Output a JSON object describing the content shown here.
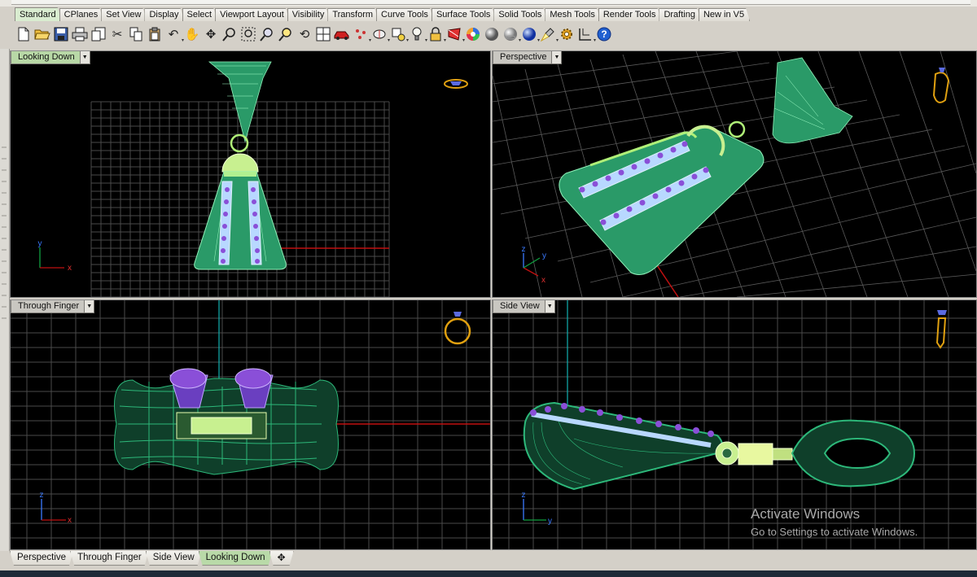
{
  "tool_tabs": [
    "Standard",
    "CPlanes",
    "Set View",
    "Display",
    "Select",
    "Viewport Layout",
    "Visibility",
    "Transform",
    "Curve Tools",
    "Surface Tools",
    "Solid Tools",
    "Mesh Tools",
    "Render Tools",
    "Drafting",
    "New in V5"
  ],
  "active_tool_tab": 0,
  "toolbar_icons": [
    "new-icon",
    "open-icon",
    "save-icon",
    "print-icon",
    "import-icon",
    "cut-icon",
    "copy-icon",
    "paste-icon",
    "undo-icon",
    "pan-icon",
    "move-view-icon",
    "zoom-icon",
    "zoom-window-icon",
    "zoom-extents-icon",
    "zoom-selected-icon",
    "rotate-view-icon",
    "four-viewports-icon",
    "car-icon",
    "points-icon",
    "cplane-icon",
    "snap-icon",
    "light-icon",
    "lock-icon",
    "material-icon",
    "color-wheel-icon",
    "shaded-sphere-icon",
    "rendered-sphere-icon",
    "blue-sphere-icon",
    "spotlight-icon",
    "gear-icon",
    "grid-snap-icon",
    "help-icon"
  ],
  "viewports": {
    "top_left": {
      "title": "Looking Down",
      "active": true
    },
    "top_right": {
      "title": "Perspective",
      "active": false
    },
    "bottom_left": {
      "title": "Through Finger",
      "active": false
    },
    "bottom_right": {
      "title": "Side View",
      "active": false
    }
  },
  "axis_labels": {
    "x": "x",
    "y": "y",
    "z": "z"
  },
  "watermark": {
    "line1": "Activate Windows",
    "line2": "Go to Settings to activate Windows."
  },
  "bottom_tabs": [
    "Perspective",
    "Through Finger",
    "Side View",
    "Looking Down"
  ],
  "active_bottom_tab": 3,
  "add_tab_symbol": "✥",
  "colors": {
    "model_green": "#2db87a",
    "gem_purple": "#8a4fd8",
    "grid": "#5a5a5a",
    "axis_red": "#c01010",
    "axis_green": "#10a040",
    "gold": "#d89a10"
  }
}
